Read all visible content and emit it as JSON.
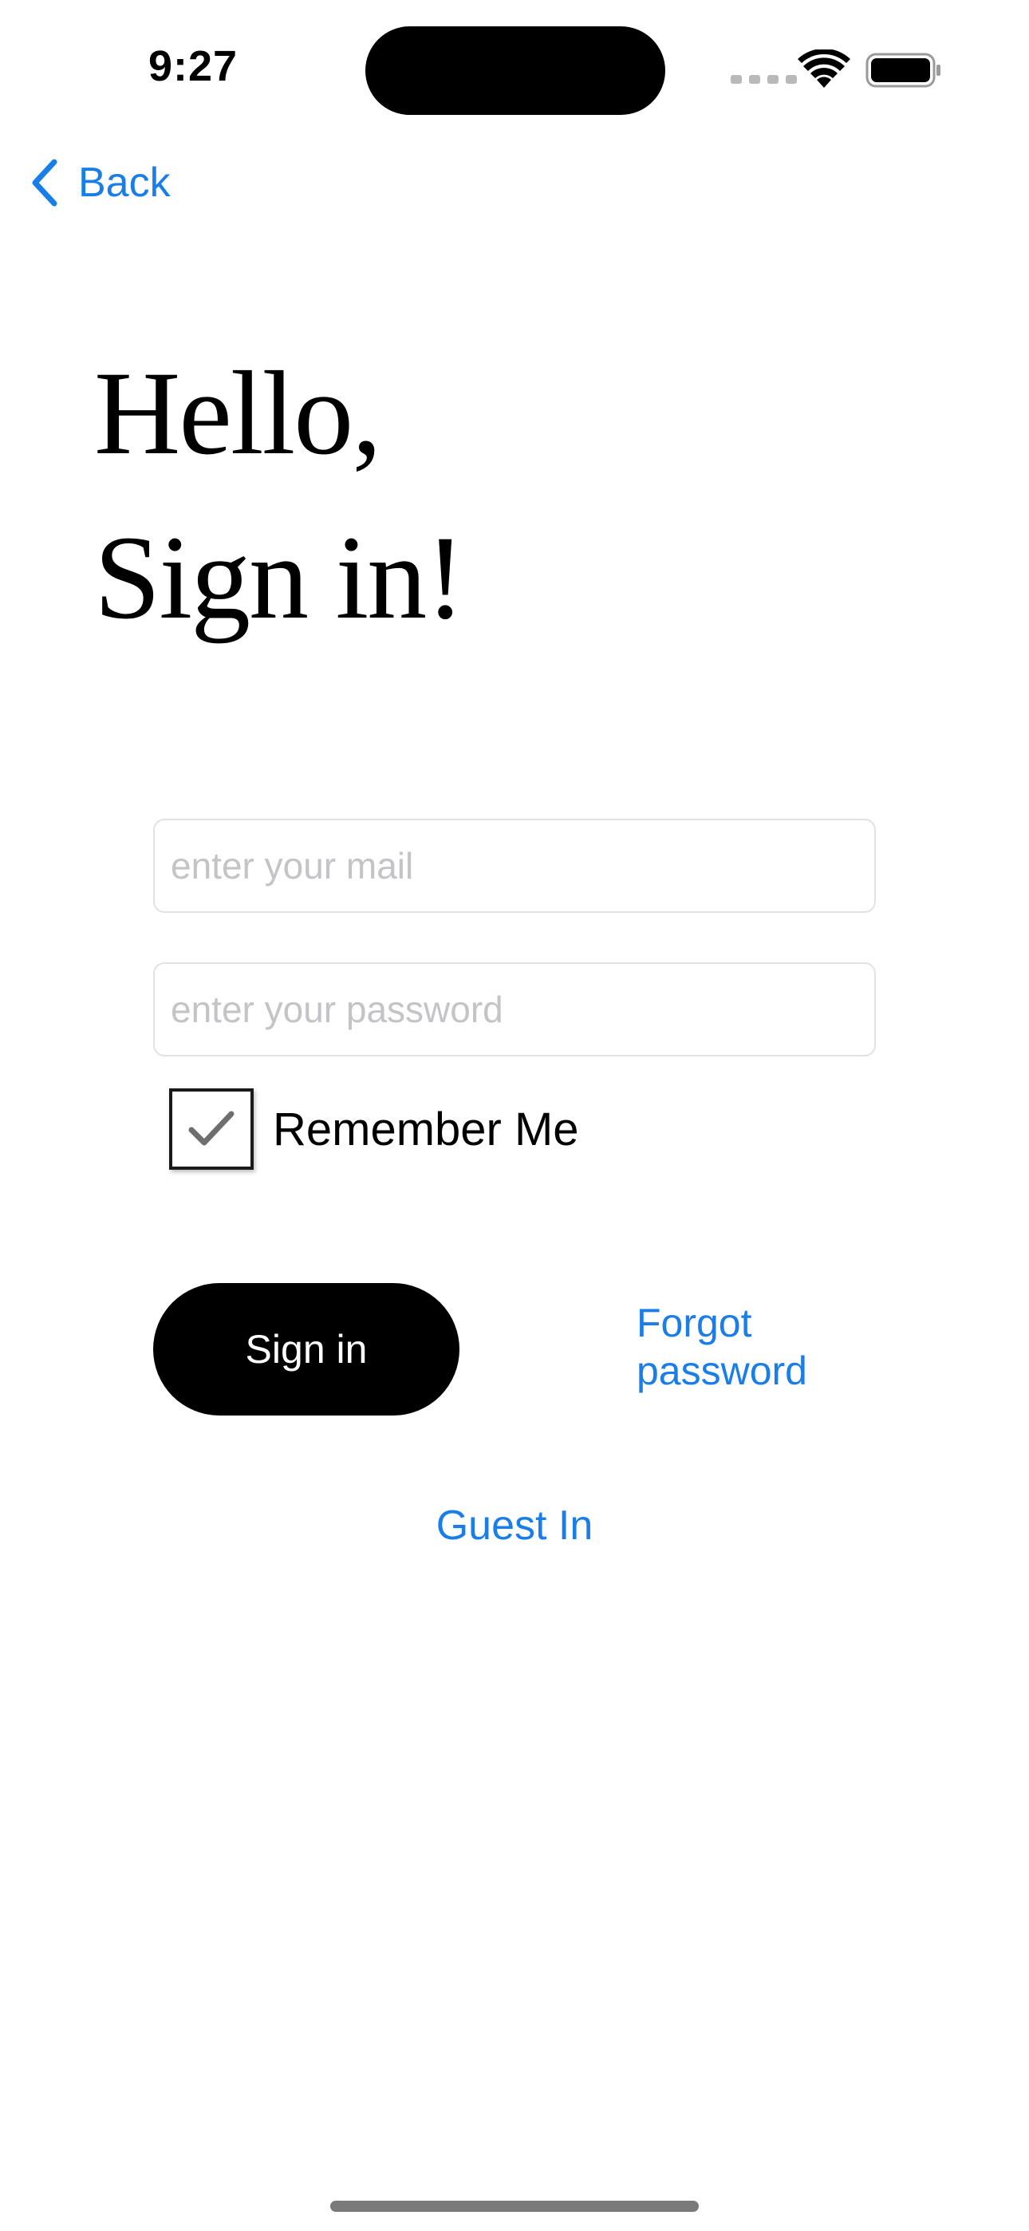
{
  "status_bar": {
    "time": "9:27",
    "icons": [
      "cellular-dots-icon",
      "wifi-icon",
      "battery-icon"
    ]
  },
  "nav": {
    "back_label": "Back",
    "back_icon": "chevron-left-icon"
  },
  "heading": {
    "line1": "Hello,",
    "line2": "Sign in!"
  },
  "form": {
    "email_placeholder": "enter your mail",
    "email_value": "",
    "password_placeholder": "enter your password",
    "password_value": "",
    "remember_label": "Remember Me",
    "remember_checked": true
  },
  "actions": {
    "sign_in_label": "Sign in",
    "forgot_line1": "Forgot",
    "forgot_line2": "password",
    "guest_label": "Guest In"
  },
  "colors": {
    "accent": "#1a7ee8",
    "primary_button": "#000000",
    "placeholder": "#c3c3c8"
  }
}
